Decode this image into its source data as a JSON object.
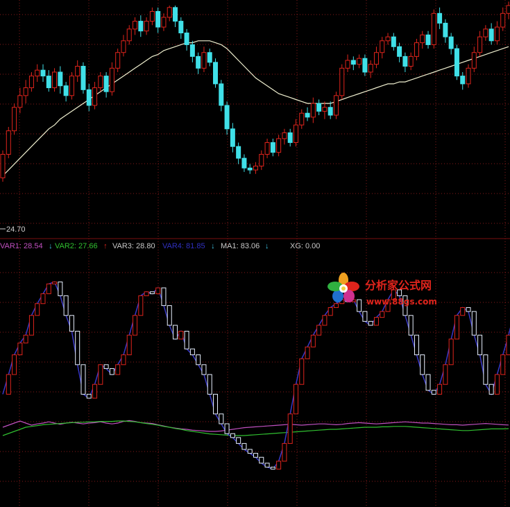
{
  "price_label": "24.70",
  "indicator_legend": [
    {
      "name": "VAR1",
      "value": "28.54",
      "arrow": "down",
      "color": "#c050c0"
    },
    {
      "name": "VAR2",
      "value": "27.66",
      "arrow": "up",
      "color": "#30c030"
    },
    {
      "name": "VAR3",
      "value": "28.80",
      "arrow": "",
      "color": "#c8c8c8"
    },
    {
      "name": "VAR4",
      "value": "81.85",
      "arrow": "down",
      "color": "#3030c0"
    },
    {
      "name": "MA1",
      "value": "83.06",
      "arrow": "down",
      "color": "#c8c8c8"
    },
    {
      "name": "XG",
      "value": "0.00",
      "arrow": "",
      "color": "#c8c8c8"
    }
  ],
  "watermark": {
    "cn": "分析家公式网",
    "url": "www.88gs.com"
  },
  "colors": {
    "up": "#e0241c",
    "down": "#40e0e8",
    "ma": "#f0f0d0",
    "grid": "#8a1a1a",
    "osc_line": "#3838c8",
    "osc_box_down": "#e8f0ff",
    "var1": "#c050c0",
    "var2": "#30c030"
  },
  "chart_data": [
    {
      "type": "candlestick",
      "title": "",
      "xlabel": "",
      "ylabel": "",
      "ylim": [
        24.0,
        33.0
      ],
      "grid": true,
      "candles": [
        [
          24.2,
          25.4,
          24.0,
          25.6
        ],
        [
          25.4,
          26.6,
          25.2,
          26.8
        ],
        [
          26.6,
          27.8,
          26.4,
          28.0
        ],
        [
          27.8,
          28.4,
          27.5,
          28.8
        ],
        [
          28.4,
          28.8,
          28.0,
          29.2
        ],
        [
          28.8,
          29.4,
          28.6,
          29.6
        ],
        [
          29.4,
          29.7,
          29.1,
          30.0
        ],
        [
          29.7,
          29.4,
          29.1,
          30.0
        ],
        [
          29.4,
          28.8,
          28.6,
          29.7
        ],
        [
          28.8,
          29.6,
          28.6,
          29.8
        ],
        [
          29.6,
          28.9,
          28.5,
          29.9
        ],
        [
          28.9,
          28.4,
          28.1,
          29.1
        ],
        [
          28.4,
          29.4,
          28.2,
          29.6
        ],
        [
          29.4,
          29.9,
          29.1,
          30.2
        ],
        [
          29.9,
          28.7,
          28.5,
          30.1
        ],
        [
          28.7,
          27.9,
          27.6,
          29.0
        ],
        [
          27.9,
          28.8,
          27.7,
          29.1
        ],
        [
          28.8,
          29.4,
          28.6,
          29.6
        ],
        [
          29.4,
          28.6,
          28.3,
          29.6
        ],
        [
          28.6,
          29.8,
          28.4,
          30.1
        ],
        [
          29.8,
          30.6,
          29.6,
          30.8
        ],
        [
          30.6,
          31.2,
          30.4,
          31.5
        ],
        [
          31.2,
          31.8,
          31.0,
          32.0
        ],
        [
          31.8,
          32.2,
          31.5,
          32.4
        ],
        [
          32.2,
          31.7,
          31.4,
          32.5
        ],
        [
          31.7,
          32.2,
          31.5,
          32.4
        ],
        [
          32.2,
          32.7,
          32.0,
          32.9
        ],
        [
          32.7,
          31.9,
          31.6,
          32.9
        ],
        [
          31.9,
          32.4,
          31.7,
          32.6
        ],
        [
          32.4,
          32.9,
          32.2,
          33.0
        ],
        [
          32.9,
          32.2,
          31.9,
          33.0
        ],
        [
          32.2,
          31.6,
          31.3,
          32.4
        ],
        [
          31.6,
          31.0,
          30.7,
          31.8
        ],
        [
          31.0,
          30.4,
          30.1,
          31.2
        ],
        [
          30.4,
          29.8,
          29.5,
          30.6
        ],
        [
          29.8,
          30.6,
          29.6,
          30.9
        ],
        [
          30.6,
          30.1,
          29.9,
          30.8
        ],
        [
          30.1,
          29.0,
          28.8,
          30.3
        ],
        [
          29.0,
          27.9,
          27.6,
          29.2
        ],
        [
          27.9,
          26.7,
          26.4,
          28.1
        ],
        [
          26.7,
          25.8,
          25.5,
          27.0
        ],
        [
          25.8,
          25.2,
          24.9,
          26.0
        ],
        [
          25.2,
          24.7,
          24.5,
          25.4
        ],
        [
          24.7,
          24.6,
          24.4,
          24.9
        ],
        [
          24.6,
          24.8,
          24.4,
          25.0
        ],
        [
          24.8,
          25.4,
          24.6,
          25.6
        ],
        [
          25.4,
          26.0,
          25.2,
          26.2
        ],
        [
          26.0,
          25.5,
          25.3,
          26.2
        ],
        [
          25.5,
          26.2,
          25.3,
          26.4
        ],
        [
          26.2,
          26.5,
          25.9,
          26.7
        ],
        [
          26.5,
          26.0,
          25.8,
          26.7
        ],
        [
          26.0,
          26.9,
          25.8,
          27.2
        ],
        [
          26.9,
          27.5,
          26.7,
          27.7
        ],
        [
          27.5,
          27.3,
          27.1,
          27.8
        ],
        [
          27.3,
          28.0,
          27.0,
          28.3
        ],
        [
          28.0,
          27.6,
          27.4,
          28.2
        ],
        [
          27.6,
          27.8,
          27.2,
          28.1
        ],
        [
          27.8,
          27.4,
          27.2,
          28.1
        ],
        [
          27.4,
          28.4,
          27.2,
          28.6
        ],
        [
          28.4,
          29.8,
          28.2,
          30.0
        ],
        [
          29.8,
          30.2,
          29.6,
          30.5
        ],
        [
          30.2,
          30.0,
          29.7,
          30.4
        ],
        [
          30.0,
          30.3,
          29.8,
          30.5
        ],
        [
          30.3,
          29.6,
          29.4,
          30.5
        ],
        [
          29.6,
          30.0,
          29.3,
          30.2
        ],
        [
          30.0,
          30.6,
          29.8,
          30.9
        ],
        [
          30.6,
          31.2,
          30.3,
          31.4
        ],
        [
          31.2,
          31.4,
          31.0,
          31.6
        ],
        [
          31.4,
          30.9,
          30.7,
          31.6
        ],
        [
          30.9,
          30.4,
          30.1,
          31.1
        ],
        [
          30.4,
          29.9,
          29.6,
          30.6
        ],
        [
          29.9,
          30.4,
          29.7,
          30.6
        ],
        [
          30.4,
          31.1,
          30.2,
          31.3
        ],
        [
          31.1,
          31.5,
          30.8,
          31.7
        ],
        [
          31.5,
          31.0,
          30.8,
          31.7
        ],
        [
          31.0,
          32.6,
          30.8,
          32.8
        ],
        [
          32.6,
          32.1,
          31.8,
          32.9
        ],
        [
          32.1,
          31.4,
          31.1,
          32.3
        ],
        [
          31.4,
          30.8,
          30.5,
          31.6
        ],
        [
          30.8,
          29.4,
          29.2,
          31.0
        ],
        [
          29.4,
          29.0,
          28.7,
          29.6
        ],
        [
          29.0,
          29.8,
          28.8,
          30.0
        ],
        [
          29.8,
          30.6,
          29.6,
          30.9
        ],
        [
          30.6,
          31.4,
          30.4,
          31.7
        ],
        [
          31.4,
          31.8,
          31.2,
          32.0
        ],
        [
          31.8,
          31.2,
          31.0,
          32.1
        ],
        [
          31.2,
          31.9,
          31.0,
          32.2
        ],
        [
          31.9,
          32.6,
          31.7,
          32.9
        ],
        [
          32.6,
          33.0,
          32.3,
          33.2
        ]
      ],
      "ma": [
        24.3,
        24.6,
        24.9,
        25.2,
        25.5,
        25.8,
        26.1,
        26.4,
        26.7,
        26.9,
        27.2,
        27.4,
        27.6,
        27.8,
        28.0,
        28.2,
        28.4,
        28.6,
        28.8,
        29.0,
        29.2,
        29.4,
        29.6,
        29.8,
        30.0,
        30.2,
        30.4,
        30.5,
        30.7,
        30.8,
        30.9,
        31.0,
        31.1,
        31.1,
        31.2,
        31.2,
        31.2,
        31.1,
        31.0,
        30.8,
        30.5,
        30.2,
        29.9,
        29.6,
        29.3,
        29.1,
        28.9,
        28.7,
        28.5,
        28.4,
        28.3,
        28.2,
        28.1,
        28.0,
        28.0,
        28.0,
        28.0,
        28.0,
        28.1,
        28.2,
        28.3,
        28.4,
        28.5,
        28.6,
        28.7,
        28.8,
        28.9,
        29.0,
        29.0,
        29.1,
        29.1,
        29.2,
        29.3,
        29.4,
        29.5,
        29.6,
        29.7,
        29.8,
        29.9,
        30.0,
        30.1,
        30.2,
        30.3,
        30.4,
        30.5,
        30.6,
        30.7,
        30.8,
        30.9
      ]
    },
    {
      "type": "line",
      "title": "",
      "xlabel": "",
      "ylabel": "",
      "ylim": [
        0,
        100
      ],
      "grid": true,
      "series": [
        {
          "name": "VAR4",
          "values": [
            40,
            50,
            60,
            66,
            70,
            80,
            86,
            91,
            96,
            97,
            90,
            80,
            72,
            55,
            40,
            38,
            45,
            55,
            53,
            50,
            55,
            60,
            70,
            80,
            90,
            92,
            91,
            94,
            85,
            75,
            68,
            72,
            63,
            60,
            55,
            50,
            40,
            30,
            25,
            20,
            18,
            15,
            12,
            10,
            8,
            5,
            3,
            2,
            6,
            15,
            30,
            45,
            58,
            64,
            70,
            75,
            80,
            84,
            86,
            88,
            87,
            88,
            82,
            77,
            75,
            79,
            82,
            88,
            93,
            90,
            80,
            70,
            60,
            50,
            42,
            40,
            45,
            55,
            68,
            80,
            84,
            82,
            70,
            60,
            45,
            40,
            50,
            60,
            70,
            82,
            88,
            85,
            92
          ]
        },
        {
          "name": "VAR1",
          "values": [
            28,
            28.5,
            29,
            29.5,
            29,
            28.5,
            28.8,
            29,
            29.3,
            29,
            28.7,
            29,
            29.2,
            29,
            28.8,
            29,
            29.1,
            29.3,
            29,
            28.8,
            29,
            29.4,
            29.6,
            29.4,
            29.1,
            29,
            28.9,
            28.6,
            28.3,
            28,
            27.8,
            27.6,
            27.5,
            27.3,
            27.2,
            27.1,
            27,
            27,
            27.1,
            27.3,
            27.5,
            27.7,
            27.9,
            28,
            28.1,
            28.2,
            28.3,
            28.4,
            28.5,
            28.6,
            28.7,
            28.6,
            28.5,
            28.6,
            28.7,
            28.8,
            28.8,
            28.7,
            28.6,
            28.7,
            28.9,
            29,
            29.1,
            29,
            28.9,
            28.8,
            28.9,
            29,
            29.1,
            29.2,
            29.3,
            29.2,
            29.1,
            29,
            29,
            28.9,
            28.8,
            28.7,
            28.6,
            28.6,
            28.5,
            28.6,
            28.7,
            28.8,
            28.9,
            28.8,
            28.7,
            28.6,
            28.54
          ]
        },
        {
          "name": "VAR2",
          "values": [
            26,
            26.5,
            27,
            27.5,
            28,
            28.2,
            28.4,
            28.6,
            28.7,
            28.8,
            28.9,
            29,
            29.1,
            29.2,
            29.2,
            29.3,
            29.3,
            29.4,
            29.4,
            29.4,
            29.5,
            29.5,
            29.4,
            29.3,
            29.1,
            28.9,
            28.7,
            28.5,
            28.2,
            28,
            27.7,
            27.5,
            27.2,
            27,
            26.8,
            26.6,
            26.4,
            26.3,
            26.2,
            26.1,
            26,
            26,
            26,
            26.1,
            26.2,
            26.3,
            26.4,
            26.5,
            26.6,
            26.7,
            26.8,
            26.9,
            27,
            27.1,
            27.2,
            27.3,
            27.4,
            27.5,
            27.5,
            27.6,
            27.7,
            27.8,
            27.9,
            28,
            28,
            28,
            28.1,
            28.1,
            28.2,
            28.2,
            28.2,
            28.1,
            28,
            27.9,
            27.8,
            27.7,
            27.6,
            27.5,
            27.4,
            27.3,
            27.2,
            27.2,
            27.3,
            27.4,
            27.5,
            27.6,
            27.6,
            27.6,
            27.66
          ]
        }
      ]
    }
  ]
}
